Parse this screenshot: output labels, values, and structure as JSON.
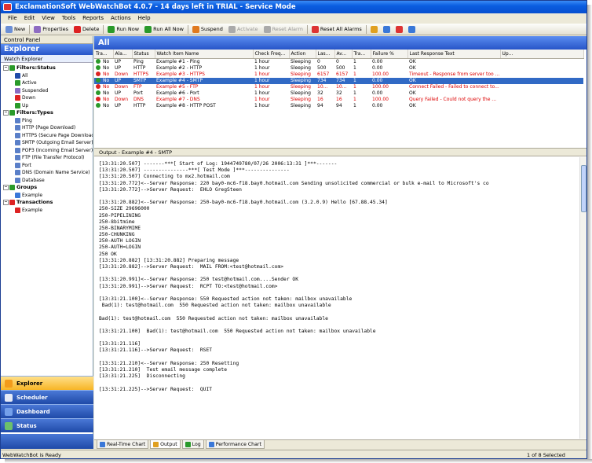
{
  "title": "ExclamationSoft WebWatchBot 4.0.7 - 14 days left in TRIAL - Service Mode",
  "menu": [
    "File",
    "Edit",
    "View",
    "Tools",
    "Reports",
    "Actions",
    "Help"
  ],
  "toolbar": [
    {
      "label": "New",
      "icon": "new-icon",
      "color": "#6b8fd6"
    },
    {
      "label": "Properties",
      "icon": "properties-icon",
      "color": "#8e6cc2"
    },
    {
      "label": "Delete",
      "icon": "delete-icon",
      "color": "#d22"
    },
    {
      "label": "Run Now",
      "icon": "run-now-icon",
      "color": "#2a9a2a"
    },
    {
      "label": "Run All Now",
      "icon": "run-all-icon",
      "color": "#2a9a2a"
    },
    {
      "label": "Suspend",
      "icon": "suspend-icon",
      "color": "#e07a1f"
    },
    {
      "label": "Activate",
      "icon": "activate-icon",
      "color": "#aaa",
      "disabled": true
    },
    {
      "label": "Reset Alarm",
      "icon": "reset-alarm-icon",
      "color": "#aaa",
      "disabled": true
    },
    {
      "label": "Reset All Alarms",
      "icon": "reset-all-alarms-icon",
      "color": "#d33"
    }
  ],
  "left": {
    "panel_title": "Control Panel",
    "explorer_title": "Explorer",
    "watch_explorer": "Watch Explorer",
    "tree": [
      {
        "label": "Filters:Status",
        "level": 0,
        "header": true,
        "icon": "filter-icon"
      },
      {
        "label": "All",
        "level": 1,
        "icon": "all-icon"
      },
      {
        "label": "Active",
        "level": 1,
        "icon": "active-icon"
      },
      {
        "label": "Suspended",
        "level": 1,
        "icon": "suspended-icon"
      },
      {
        "label": "Down",
        "level": 1,
        "icon": "down-icon"
      },
      {
        "label": "Up",
        "level": 1,
        "icon": "up-icon"
      },
      {
        "label": "Filters:Types",
        "level": 0,
        "header": true,
        "icon": "filter-icon"
      },
      {
        "label": "Ping",
        "level": 1,
        "icon": "ping-icon"
      },
      {
        "label": "HTTP (Page Download)",
        "level": 1,
        "icon": "http-icon"
      },
      {
        "label": "HTTPS (Secure Page Download)",
        "level": 1,
        "icon": "https-icon"
      },
      {
        "label": "SMTP (Outgoing Email Server)",
        "level": 1,
        "icon": "smtp-icon"
      },
      {
        "label": "POP3 (Incoming Email Server)",
        "level": 1,
        "icon": "pop3-icon"
      },
      {
        "label": "FTP (File Transfer Protocol)",
        "level": 1,
        "icon": "ftp-icon"
      },
      {
        "label": "Port",
        "level": 1,
        "icon": "port-icon"
      },
      {
        "label": "DNS (Domain Name Service)",
        "level": 1,
        "icon": "dns-icon"
      },
      {
        "label": "Database",
        "level": 1,
        "icon": "database-icon"
      },
      {
        "label": "Groups",
        "level": 0,
        "header": true,
        "icon": "groups-icon"
      },
      {
        "label": "Example",
        "level": 1,
        "icon": "group-icon"
      },
      {
        "label": "Transactions",
        "level": 0,
        "header": true,
        "icon": "transactions-icon"
      },
      {
        "label": "Example",
        "level": 1,
        "icon": "transaction-icon"
      }
    ],
    "nav": [
      {
        "label": "Explorer",
        "selected": true,
        "color": "#f39b1a"
      },
      {
        "label": "Scheduler",
        "color": "#e6eaf6"
      },
      {
        "label": "Dashboard",
        "color": "#74a0ea"
      },
      {
        "label": "Status",
        "color": "#6cc06c"
      }
    ]
  },
  "list": {
    "title": "All",
    "columns": [
      "Tra...",
      "Ala...",
      "Status",
      "Watch Item Name",
      "Check Freq...",
      "Action",
      "Las...",
      "Av...",
      "Tra...",
      "Failure %",
      "Last Response Text",
      "Up..."
    ],
    "rows": [
      {
        "tra": "No",
        "ala": "UP",
        "status": "Ping",
        "name": "Example #1 - Ping",
        "freq": "1 hour",
        "action": "Sleeping",
        "las": "0",
        "av": "0",
        "tra2": "1",
        "fail": "0.00",
        "resp": "OK",
        "state": "up"
      },
      {
        "tra": "No",
        "ala": "UP",
        "status": "HTTP",
        "name": "Example #2 - HTTP",
        "freq": "1 hour",
        "action": "Sleeping",
        "las": "500",
        "av": "500",
        "tra2": "1",
        "fail": "0.00",
        "resp": "OK",
        "state": "up"
      },
      {
        "tra": "No",
        "ala": "Down",
        "status": "HTTPS",
        "name": "Example #3 - HTTPS",
        "freq": "1 hour",
        "action": "Sleeping",
        "las": "6157",
        "av": "6157",
        "tra2": "1",
        "fail": "100.00",
        "resp": "Timeout - Response from server too ...",
        "state": "down"
      },
      {
        "tra": "No",
        "ala": "UP",
        "status": "SMTP",
        "name": "Example #4 - SMTP",
        "freq": "1 hour",
        "action": "Sleeping",
        "las": "734",
        "av": "734",
        "tra2": "1",
        "fail": "0.00",
        "resp": "OK",
        "state": "selected"
      },
      {
        "tra": "No",
        "ala": "Down",
        "status": "FTP",
        "name": "Example #5 - FTP",
        "freq": "1 hour",
        "action": "Sleeping",
        "las": "10...",
        "av": "10...",
        "tra2": "1",
        "fail": "100.00",
        "resp": "Connect Failed - Failed to connect to...",
        "state": "down"
      },
      {
        "tra": "No",
        "ala": "UP",
        "status": "Port",
        "name": "Example #6 - Port",
        "freq": "1 hour",
        "action": "Sleeping",
        "las": "32",
        "av": "32",
        "tra2": "1",
        "fail": "0.00",
        "resp": "OK",
        "state": "up"
      },
      {
        "tra": "No",
        "ala": "Down",
        "status": "DNS",
        "name": "Example #7 - DNS",
        "freq": "1 hour",
        "action": "Sleeping",
        "las": "16",
        "av": "16",
        "tra2": "1",
        "fail": "100.00",
        "resp": "Query Failed - Could not query the ...",
        "state": "down"
      },
      {
        "tra": "No",
        "ala": "UP",
        "status": "HTTP",
        "name": "Example #8 - HTTP POST",
        "freq": "1 hour",
        "action": "Sleeping",
        "las": "94",
        "av": "94",
        "tra2": "1",
        "fail": "0.00",
        "resp": "OK",
        "state": "up"
      }
    ]
  },
  "output": {
    "title": "Output - Example #4 - SMTP",
    "lines": [
      "[13:31:20.507] -------***[ Start of Log: 1944749780/07/26 2006:13:31 ]***-------",
      "[13:31:20.507] ---------------***[ Test Mode ]***---------------",
      "[13:31:20.507] Connecting to mx2.hotmail.com",
      "[13:31:20.772]<--Server Response: 220 bay0-mc6-f18.bay0.hotmail.com Sending unsolicited commercial or bulk e-mail to Microsoft's co",
      "[13:31:20.772]-->Server Request:  EHLO GregSteen",
      "",
      "[13:31:20.882]<--Server Response: 250-bay0-mc6-f18.bay0.hotmail.com (3.2.0.9) Hello [67.88.45.34]",
      "250-SIZE 29696000",
      "250-PIPELINING",
      "250-8bitmime",
      "250-BINARYMIME",
      "250-CHUNKING",
      "250-AUTH LOGIN",
      "250-AUTH=LOGIN",
      "250 OK",
      "[13:31:20.882] [13:31:20.882] Preparing message",
      "[13:31:20.882]-->Server Request:  MAIL FROM:<test@hotmail.com>",
      "",
      "[13:31:20.991]<--Server Response: 250 test@hotmail.com....Sender OK",
      "[13:31:20.991]-->Server Request:  RCPT TO:<test@hotmail.com>",
      "",
      "[13:31:21.100]<--Server Response: 550 Requested action not taken: mailbox unavailable",
      " Bad(1): test@hotmail.com  550 Requested action not taken: mailbox unavailable",
      "",
      "Bad(1): test@hotmail.com  550 Requested action not taken: mailbox unavailable",
      "",
      "[13:31:21.100]  Bad(1): test@hotmail.com  550 Requested action not taken: mailbox unavailable",
      "",
      "[13:31:21.116]",
      "[13:31:21.116]-->Server Request:  RSET",
      "",
      "[13:31:21.210]<--Server Response: 250 Resetting",
      "[13:31:21.210]  Test email message complete",
      "[13:31:21.225]  Disconnecting",
      "",
      "[13:31:21.225]-->Server Request:  QUIT"
    ]
  },
  "bottom_tabs": [
    {
      "label": "Real-Time Chart",
      "icon": "chart-icon",
      "color": "#3a78d8"
    },
    {
      "label": "Output",
      "icon": "output-icon",
      "color": "#e0a020",
      "active": true
    },
    {
      "label": "Log",
      "icon": "log-icon",
      "color": "#2a9a2a"
    },
    {
      "label": "Performance Chart",
      "icon": "performance-chart-icon",
      "color": "#3a78d8"
    }
  ],
  "status": {
    "left": "WebWatchBot is Ready",
    "right": "1 of 8 Selected"
  }
}
